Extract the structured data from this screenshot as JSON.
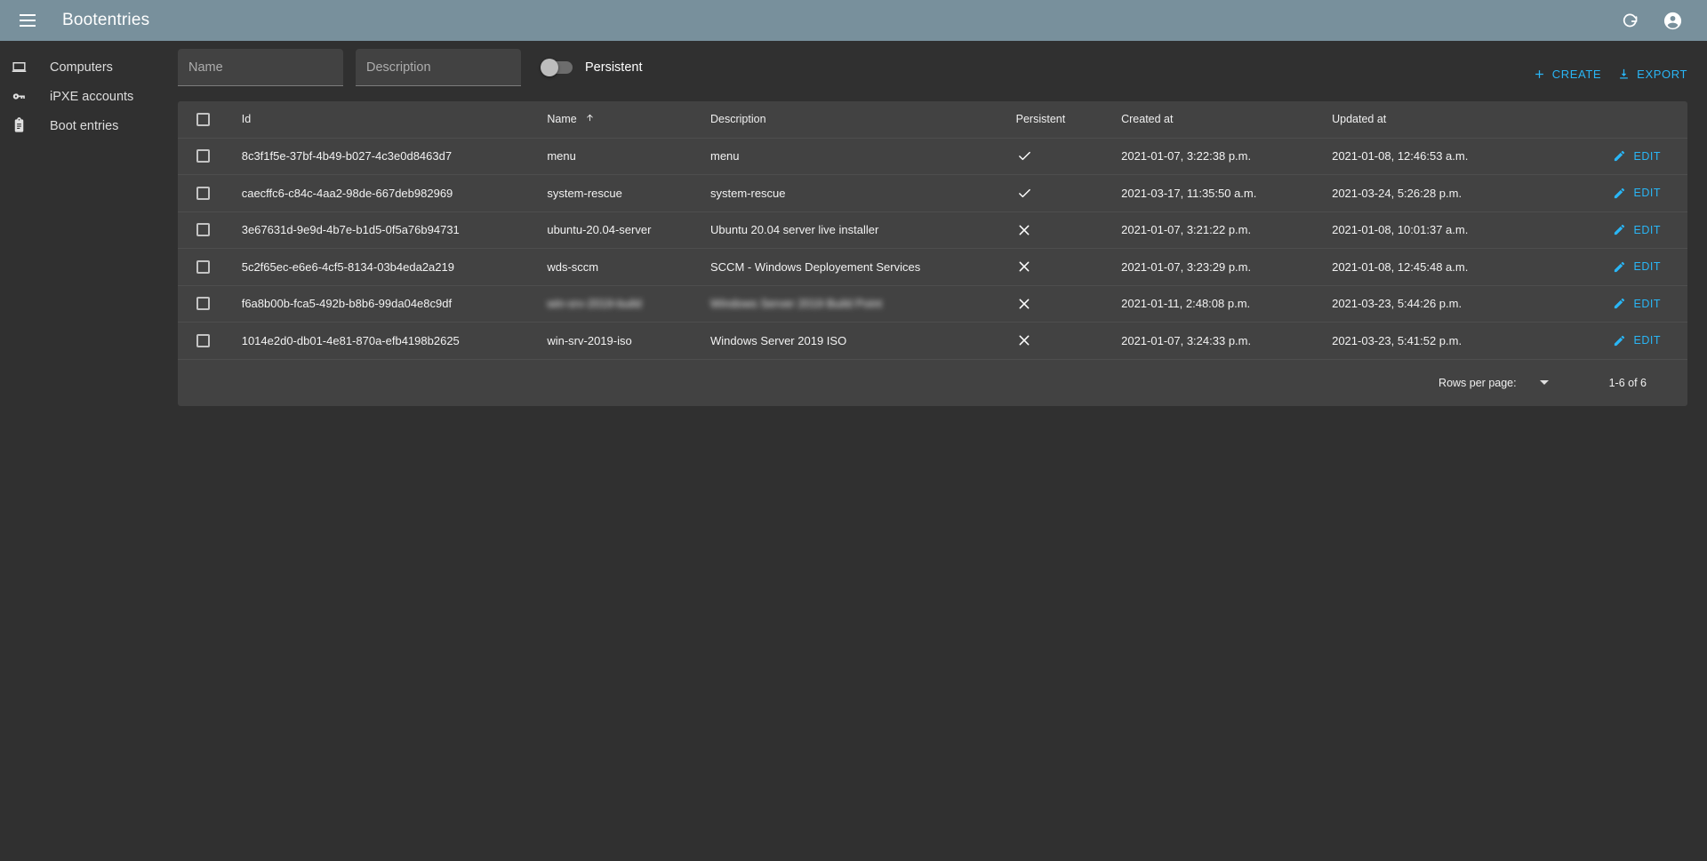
{
  "appbar": {
    "title": "Bootentries",
    "menu_icon": "hamburger-menu-icon",
    "refresh_icon": "refresh-icon",
    "account_icon": "account-circle-icon"
  },
  "sidebar": {
    "items": [
      {
        "label": "Computers",
        "icon": "laptop-icon"
      },
      {
        "label": "iPXE accounts",
        "icon": "key-icon"
      },
      {
        "label": "Boot entries",
        "icon": "clipboard-list-icon"
      }
    ]
  },
  "toolbar": {
    "name_filter": {
      "placeholder": "Name",
      "value": ""
    },
    "description_filter": {
      "placeholder": "Description",
      "value": ""
    },
    "persistent_toggle": {
      "label": "Persistent",
      "checked": false
    },
    "create_label": "CREATE",
    "export_label": "EXPORT",
    "create_icon": "plus-icon",
    "export_icon": "download-icon"
  },
  "table": {
    "columns": [
      "Id",
      "Name",
      "Description",
      "Persistent",
      "Created at",
      "Updated at"
    ],
    "sort": {
      "column": "Name",
      "direction": "asc",
      "icon": "arrow-up-icon"
    },
    "select_all_checked": false,
    "edit_label": "EDIT",
    "edit_icon": "pencil-icon",
    "rows": [
      {
        "id": "8c3f1f5e-37bf-4b49-b027-4c3e0d8463d7",
        "name": "menu",
        "description": "menu",
        "persistent": true,
        "created_at": "2021-01-07, 3:22:38 p.m.",
        "updated_at": "2021-01-08, 12:46:53 a.m.",
        "redacted": false
      },
      {
        "id": "caecffc6-c84c-4aa2-98de-667deb982969",
        "name": "system-rescue",
        "description": "system-rescue",
        "persistent": true,
        "created_at": "2021-03-17, 11:35:50 a.m.",
        "updated_at": "2021-03-24, 5:26:28 p.m.",
        "redacted": false
      },
      {
        "id": "3e67631d-9e9d-4b7e-b1d5-0f5a76b94731",
        "name": "ubuntu-20.04-server",
        "description": "Ubuntu 20.04 server live installer",
        "persistent": false,
        "created_at": "2021-01-07, 3:21:22 p.m.",
        "updated_at": "2021-01-08, 10:01:37 a.m.",
        "redacted": false
      },
      {
        "id": "5c2f65ec-e6e6-4cf5-8134-03b4eda2a219",
        "name": "wds-sccm",
        "description": "SCCM - Windows Deployement Services",
        "persistent": false,
        "created_at": "2021-01-07, 3:23:29 p.m.",
        "updated_at": "2021-01-08, 12:45:48 a.m.",
        "redacted": false
      },
      {
        "id": "f6a8b00b-fca5-492b-b8b6-99da04e8c9df",
        "name": "win-srv-2019-build",
        "description": "Windows Server 2019 Build Point",
        "persistent": false,
        "created_at": "2021-01-11, 2:48:08 p.m.",
        "updated_at": "2021-03-23, 5:44:26 p.m.",
        "redacted": true
      },
      {
        "id": "1014e2d0-db01-4e81-870a-efb4198b2625",
        "name": "win-srv-2019-iso",
        "description": "Windows Server 2019 ISO",
        "persistent": false,
        "created_at": "2021-01-07, 3:24:33 p.m.",
        "updated_at": "2021-03-23, 5:41:52 p.m.",
        "redacted": false
      }
    ]
  },
  "paginator": {
    "rows_per_page_label": "Rows per page:",
    "rows_per_page_value": "",
    "range_label": "1-6 of 6"
  },
  "colors": {
    "appbar": "#78909c",
    "page_bg": "#303030",
    "surface": "#424242",
    "accent": "#29b6f6",
    "divider": "#4e4e4e"
  }
}
